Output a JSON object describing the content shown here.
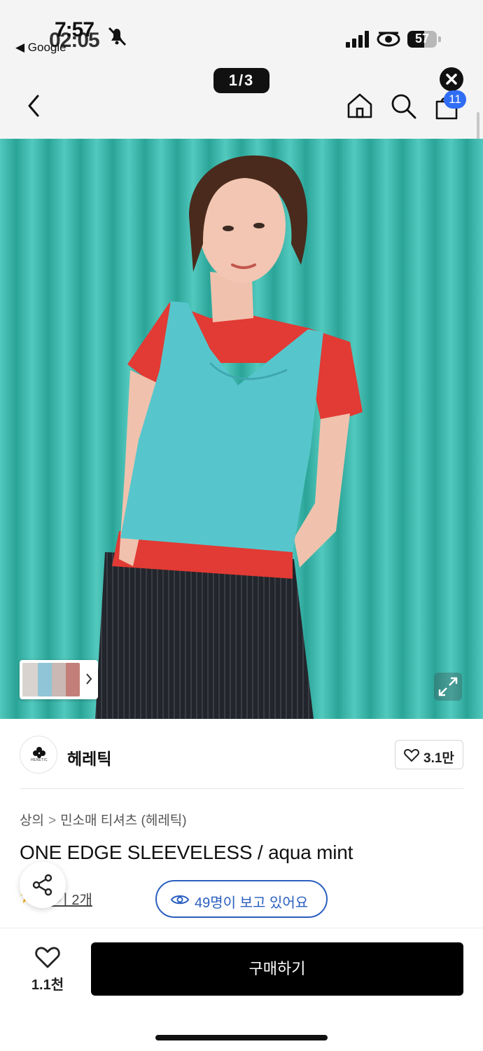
{
  "status_bar": {
    "time_primary": "7:57",
    "time_overlay": "02:05",
    "back_app_label": "◀ Google",
    "battery_level": "57",
    "battery_fraction": 0.57
  },
  "nav": {
    "page_indicator": "1/3",
    "cart_count": "11"
  },
  "product": {
    "brand_name": "헤레틱",
    "brand_logo_text": "HERETIC",
    "brand_likes": "3.1만",
    "breadcrumb": [
      "상의",
      "민소매 티셔츠 (헤레틱)"
    ],
    "breadcrumb_separator": ">",
    "title": "ONE EDGE SLEEVELESS / aqua mint",
    "reviews_link": "후기 2개",
    "viewers_text": "49명이 보고 있어요"
  },
  "bottom_bar": {
    "like_count": "1.1천",
    "buy_label": "구매하기"
  },
  "colors": {
    "accent_blue": "#2a5fbf",
    "badge_blue": "#2f6df5",
    "curtain_aqua": "#3cc0b4",
    "buy_button": "#000000"
  },
  "icons": [
    "bell-off-icon",
    "signal-icon",
    "focus-icon",
    "battery-icon",
    "back-arrow-icon",
    "close-icon",
    "home-icon",
    "search-icon",
    "cart-icon",
    "expand-icon",
    "heart-icon",
    "share-icon",
    "star-icon",
    "eye-icon"
  ]
}
